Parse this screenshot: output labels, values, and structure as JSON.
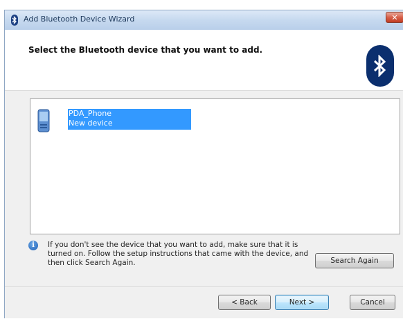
{
  "window": {
    "title": "Add Bluetooth Device Wizard",
    "close_label": "✕"
  },
  "header": {
    "title": "Select the Bluetooth device that you want to add."
  },
  "devices": [
    {
      "name": "PDA_Phone",
      "status": "New device",
      "icon": "pda-phone-icon",
      "selected": true
    }
  ],
  "info": {
    "icon": "info-icon",
    "text": "If you don't see the device that you want to add, make sure that it is turned on. Follow the setup instructions that came with the device, and then click Search Again."
  },
  "buttons": {
    "search_again": "Search Again",
    "back": "< Back",
    "next": "Next >",
    "cancel": "Cancel"
  },
  "colors": {
    "selection": "#3399ff",
    "bluetooth_badge": "#0b2f6e"
  }
}
